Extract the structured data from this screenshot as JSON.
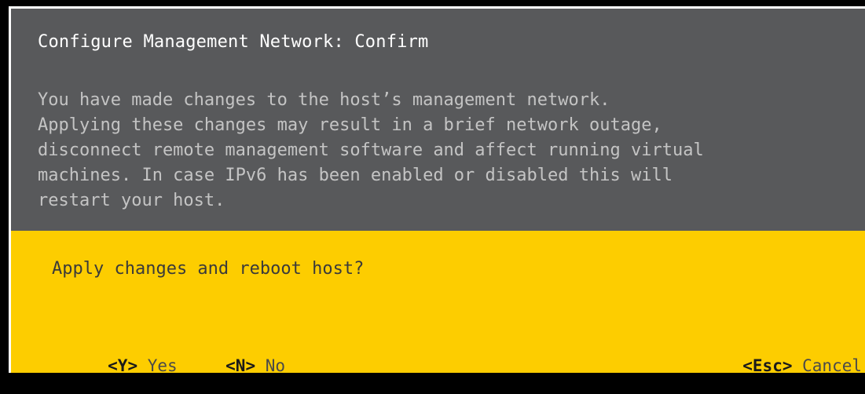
{
  "dialog": {
    "title": "Configure Management Network: Confirm",
    "message_lines": [
      "You have made changes to the host’s management network.",
      "Applying these changes may result in a brief network outage,",
      "disconnect remote management software and affect running virtual",
      "machines. In case IPv6 has been enabled or disabled this will",
      "restart your host."
    ],
    "question": "Apply changes and reboot host?",
    "actions": {
      "yes": {
        "key": "<Y>",
        "label": "Yes"
      },
      "no": {
        "key": "<N>",
        "label": "No"
      },
      "cancel": {
        "key": "<Esc>",
        "label": "Cancel"
      }
    }
  },
  "colors": {
    "top_panel": "#58595b",
    "bottom_panel": "#fdcd00",
    "title_text": "#ffffff",
    "message_text": "#c4c4c4"
  }
}
